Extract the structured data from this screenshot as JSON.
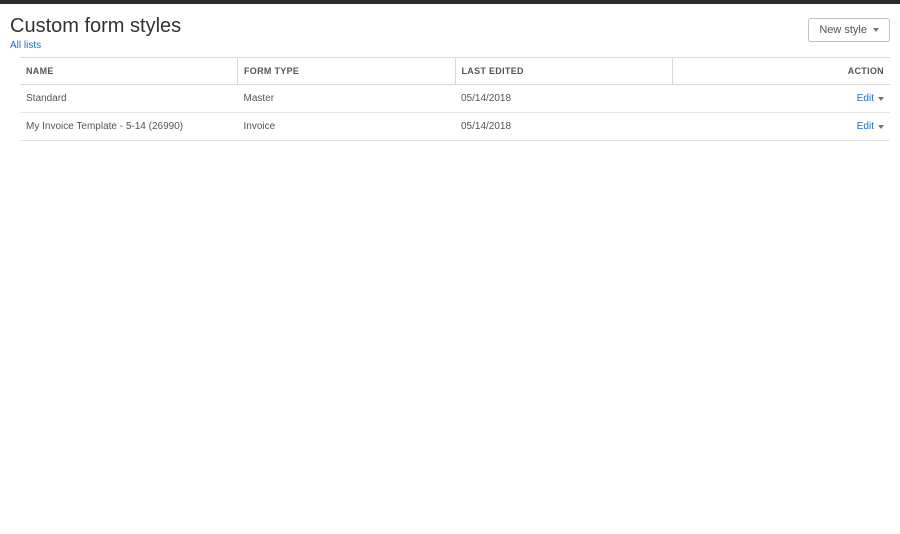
{
  "header": {
    "title": "Custom form styles",
    "all_lists_label": "All lists",
    "new_style_label": "New style"
  },
  "table": {
    "columns": {
      "name": "NAME",
      "form_type": "FORM TYPE",
      "last_edited": "LAST EDITED",
      "action": "ACTION"
    },
    "rows": [
      {
        "name": "Standard",
        "form_type": "Master",
        "last_edited": "05/14/2018",
        "action_label": "Edit"
      },
      {
        "name": "My Invoice Template - 5-14 (26990)",
        "form_type": "Invoice",
        "last_edited": "05/14/2018",
        "action_label": "Edit"
      }
    ]
  }
}
